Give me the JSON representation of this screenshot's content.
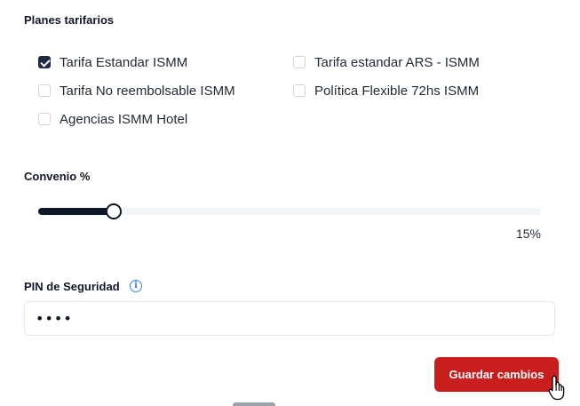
{
  "plans": {
    "title": "Planes tarifarios",
    "items": [
      {
        "label": "Tarifa Estandar ISMM",
        "checked": true
      },
      {
        "label": "Tarifa estandar ARS - ISMM",
        "checked": false
      },
      {
        "label": "Tarifa No reembolsable ISMM",
        "checked": false
      },
      {
        "label": "Política Flexible 72hs ISMM",
        "checked": false
      },
      {
        "label": "Agencias ISMM Hotel",
        "checked": false
      }
    ]
  },
  "convenio": {
    "title": "Convenio %",
    "value": 15,
    "max": 100,
    "value_label": "15%"
  },
  "pin": {
    "title": "PIN de Seguridad",
    "info_icon": "info-icon",
    "value": "••••"
  },
  "actions": {
    "save_label": "Guardar cambios"
  },
  "colors": {
    "accent": "#c81e1e",
    "slider": "#0f172a",
    "info": "#3b82f6"
  }
}
